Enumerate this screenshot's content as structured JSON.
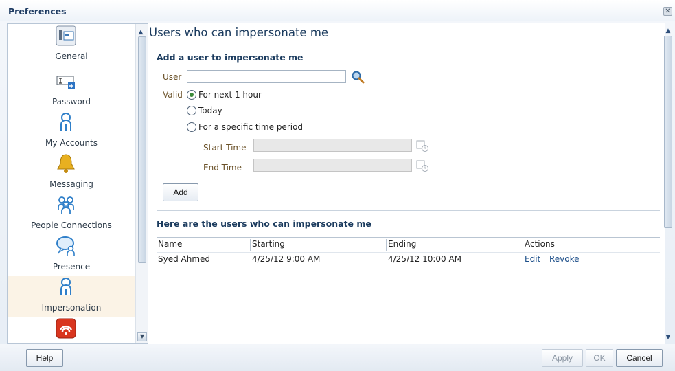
{
  "window": {
    "title": "Preferences",
    "close_icon": "close-icon"
  },
  "sidebar": {
    "items": [
      {
        "label": "General",
        "icon": "general-settings-icon"
      },
      {
        "label": "Password",
        "icon": "password-icon"
      },
      {
        "label": "My Accounts",
        "icon": "user-icon"
      },
      {
        "label": "Messaging",
        "icon": "bell-icon"
      },
      {
        "label": "People Connections",
        "icon": "people-icon"
      },
      {
        "label": "Presence",
        "icon": "presence-chat-icon"
      },
      {
        "label": "Impersonation",
        "icon": "user-icon",
        "selected": true
      },
      {
        "label": "",
        "icon": "rss-feed-icon"
      }
    ]
  },
  "main": {
    "title": "Users who can impersonate me",
    "add_section": {
      "title": "Add a user to impersonate me",
      "user_label": "User",
      "user_value": "",
      "valid_label": "Valid",
      "options": [
        {
          "label": "For next 1 hour",
          "checked": true
        },
        {
          "label": "Today",
          "checked": false
        },
        {
          "label": "For a specific time period",
          "checked": false
        }
      ],
      "start_time_label": "Start Time",
      "end_time_label": "End Time",
      "add_button": "Add"
    },
    "list_section": {
      "title": "Here are the users who can impersonate me",
      "columns": [
        "Name",
        "Starting",
        "Ending",
        "Actions"
      ],
      "rows": [
        {
          "name": "Syed Ahmed",
          "starting": "4/25/12 9:00 AM",
          "ending": "4/25/12 10:00 AM",
          "edit": "Edit",
          "revoke": "Revoke"
        }
      ]
    }
  },
  "footer": {
    "help": "Help",
    "apply": "Apply",
    "ok": "OK",
    "cancel": "Cancel"
  },
  "colors": {
    "title_text": "#1b3b5e",
    "form_label": "#6a5128",
    "link": "#1d4f8a",
    "selected_item_bg": "#fbf3e6"
  }
}
